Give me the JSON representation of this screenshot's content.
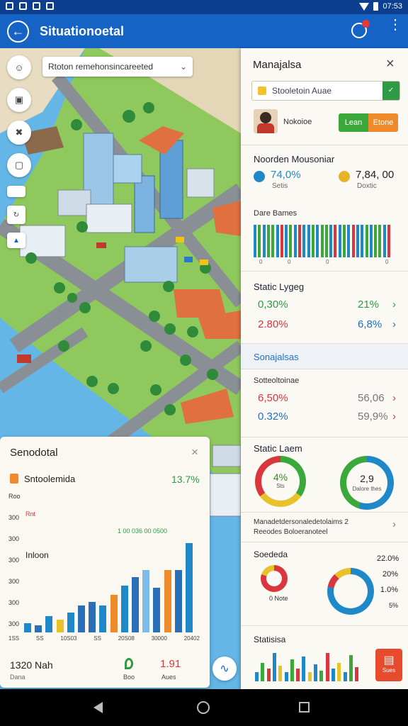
{
  "status_bar": {
    "time": "07:53"
  },
  "app_bar": {
    "title": "Situationoetal"
  },
  "map": {
    "search_placeholder": "Rtoton remehonsincareeted"
  },
  "right_panel": {
    "title": "Manajalsa",
    "search_value": "Stooletoin Auae",
    "profile_name": "Nokoioe",
    "btn_left": "Lean",
    "btn_right": "Etone",
    "section1": {
      "title": "Noorden Mousoniar",
      "stat_a": {
        "value": "74,0%",
        "label": "Setis"
      },
      "stat_b": {
        "value": "7,84, 00",
        "label": "Doxtic"
      },
      "chart_title": "Dare Bames",
      "ticks": [
        "0",
        "0",
        "0",
        "0"
      ]
    },
    "section2": {
      "title": "Static Lygeg",
      "rows": [
        {
          "left": "0,30%",
          "right": "21%"
        },
        {
          "left": "2.80%",
          "right": "6,8%"
        }
      ]
    },
    "section3": {
      "title": "Sonajalsas"
    },
    "section4": {
      "subtitle": "Sotteoltoinae",
      "rows": [
        {
          "left": "6,50%",
          "right": "56,06"
        },
        {
          "left": "0.32%",
          "right": "59,9%"
        }
      ]
    },
    "section5": {
      "title": "Static Laem",
      "donut_a": {
        "value": "4%",
        "label": "Sts"
      },
      "donut_b": {
        "value": "2,9",
        "label": "Dalore thes"
      }
    },
    "section6": {
      "line1": "Manadetdersonaledetolaims 2",
      "line2": "Reeodes Boloeranoteel"
    },
    "section7": {
      "title": "Soededa",
      "legend": [
        "22.0%",
        "20%",
        "1.0%",
        "5%"
      ],
      "note": "0 Note"
    },
    "section8": {
      "title": "Statisisa",
      "action_label": "Sues"
    }
  },
  "bottom_card": {
    "title": "Senodotal",
    "item_label": "Sntoolemida",
    "item_value": "13.7%",
    "ylabels": [
      "Roo",
      "300",
      "300",
      "300",
      "300",
      "300",
      "300"
    ],
    "annot_a": "Rnt",
    "annot_b": "1 00 036 00 0500",
    "annot_c": "Inloon",
    "xlabels": [
      "1SS",
      "SS",
      "10S03",
      "SS",
      "20S08",
      "30000",
      "20402"
    ],
    "footer_value": "1320 Nah",
    "footer_label": "Dana",
    "mid_label": "Boo",
    "right_value": "1.91",
    "right_label": "Aues"
  },
  "colors": {
    "appbar": "#1463c5",
    "accent_green": "#3aa83a",
    "accent_orange": "#ef8a2a",
    "accent_red": "#d9363e",
    "accent_blue": "#2a78c9"
  }
}
